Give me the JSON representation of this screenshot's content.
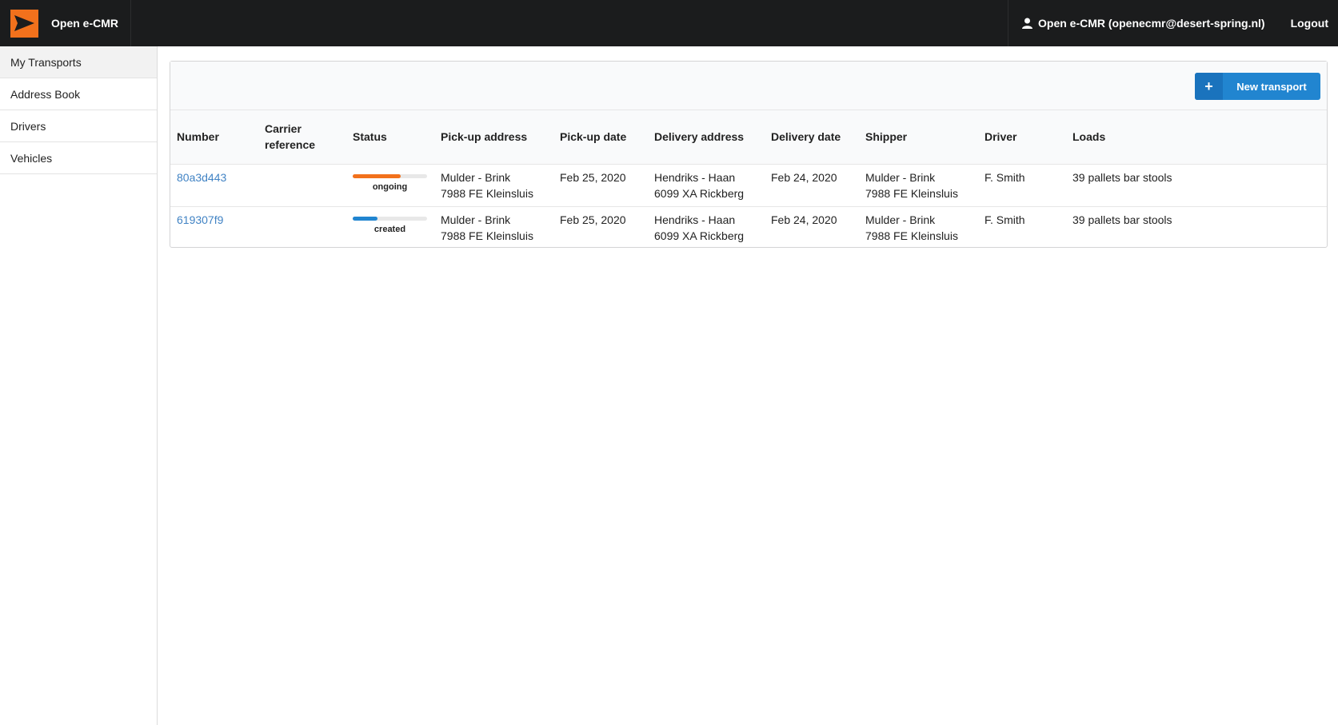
{
  "app": {
    "title": "Open e-CMR",
    "logo_icon": "paper-plane-icon",
    "accent_color": "#f2711c"
  },
  "user": {
    "label": "Open e-CMR (openecmr@desert-spring.nl)",
    "icon": "user-icon",
    "logout_label": "Logout"
  },
  "sidebar": {
    "items": [
      {
        "label": "My Transports",
        "active": true
      },
      {
        "label": "Address Book",
        "active": false
      },
      {
        "label": "Drivers",
        "active": false
      },
      {
        "label": "Vehicles",
        "active": false
      }
    ]
  },
  "toolbar": {
    "new_transport_label": "New transport",
    "new_transport_icon": "plus-icon",
    "button_color": "#2185d0"
  },
  "table": {
    "headers": {
      "number": "Number",
      "carrier_reference": "Carrier reference",
      "status": "Status",
      "pickup_address": "Pick-up address",
      "pickup_date": "Pick-up date",
      "delivery_address": "Delivery address",
      "delivery_date": "Delivery date",
      "shipper": "Shipper",
      "driver": "Driver",
      "loads": "Loads"
    },
    "rows": [
      {
        "number": "80a3d443",
        "carrier_reference": "",
        "status": "ongoing",
        "status_progress": 0.65,
        "status_color": "#f2711c",
        "pickup_name": "Mulder - Brink",
        "pickup_city": "7988 FE Kleinsluis",
        "pickup_date": "Feb 25, 2020",
        "delivery_name": "Hendriks - Haan",
        "delivery_city": "6099 XA Rickberg",
        "delivery_date": "Feb 24, 2020",
        "shipper_name": "Mulder - Brink",
        "shipper_city": "7988 FE Kleinsluis",
        "driver": "F. Smith",
        "loads": "39 pallets bar stools"
      },
      {
        "number": "619307f9",
        "carrier_reference": "",
        "status": "created",
        "status_progress": 0.33,
        "status_color": "#2185d0",
        "pickup_name": "Mulder - Brink",
        "pickup_city": "7988 FE Kleinsluis",
        "pickup_date": "Feb 25, 2020",
        "delivery_name": "Hendriks - Haan",
        "delivery_city": "6099 XA Rickberg",
        "delivery_date": "Feb 24, 2020",
        "shipper_name": "Mulder - Brink",
        "shipper_city": "7988 FE Kleinsluis",
        "driver": "F. Smith",
        "loads": "39 pallets bar stools"
      }
    ]
  }
}
